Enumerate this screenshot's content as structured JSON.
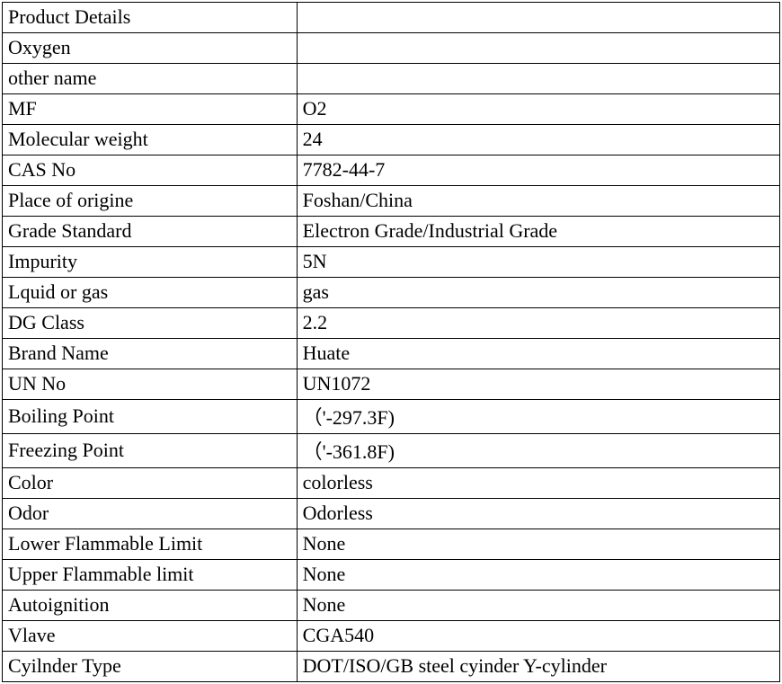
{
  "rows": [
    {
      "label": "Product Details",
      "value": ""
    },
    {
      "label": "Oxygen",
      "value": ""
    },
    {
      "label": "other name",
      "value": ""
    },
    {
      "label": "MF",
      "value": "O2"
    },
    {
      "label": "Molecular weight",
      "value": "24"
    },
    {
      "label": "CAS No",
      "value": "7782-44-7"
    },
    {
      "label": "Place of origine",
      "value": "Foshan/China"
    },
    {
      "label": "Grade Standard",
      "value": "Electron Grade/Industrial Grade"
    },
    {
      "label": "Impurity",
      "value": "5N"
    },
    {
      "label": "Lquid or gas",
      "value": "gas"
    },
    {
      "label": "DG Class",
      "value": "2.2"
    },
    {
      "label": "Brand Name",
      "value": "Huate"
    },
    {
      "label": "UN No",
      "value": "UN1072"
    },
    {
      "label": "Boiling Point",
      "value": "（'-297.3F)"
    },
    {
      "label": "Freezing Point",
      "value": "（'-361.8F)"
    },
    {
      "label": "Color",
      "value": " colorless"
    },
    {
      "label": "Odor",
      "value": "Odorless"
    },
    {
      "label": "Lower Flammable Limit",
      "value": "None"
    },
    {
      "label": "Upper Flammable limit",
      "value": "None"
    },
    {
      "label": "Autoignition",
      "value": "None"
    },
    {
      "label": "Vlave",
      "value": "CGA540"
    },
    {
      "label": "Cyilnder Type",
      "value": "DOT/ISO/GB steel cyinder  Y-cylinder"
    }
  ]
}
